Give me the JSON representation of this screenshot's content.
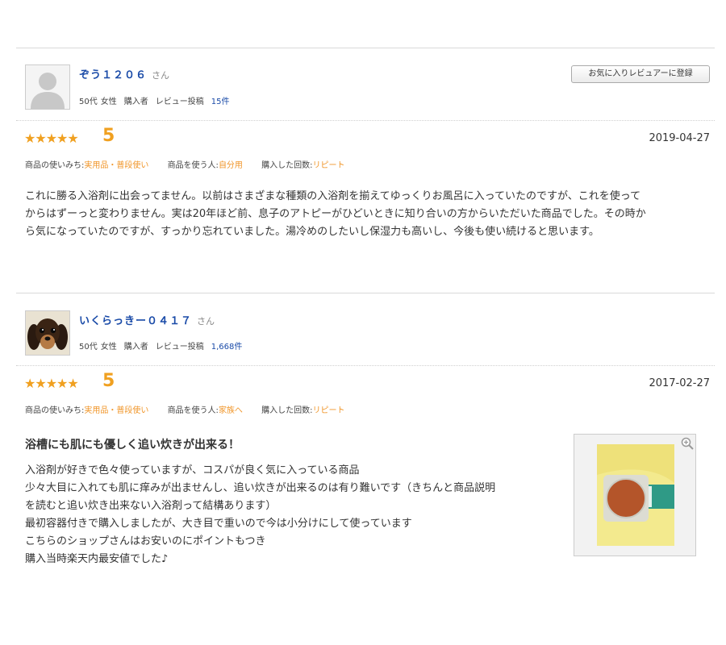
{
  "reviews": [
    {
      "reviewer": {
        "name": "ぞう１２０６",
        "suffix": "さん",
        "age": "50代",
        "gender": "女性",
        "status": "購入者",
        "post_label": "レビュー投稿",
        "post_count": "15件"
      },
      "favorite_button": "お気に入りレビュアーに登録",
      "stars": "★★★★★",
      "score": "5",
      "date": "2019-04-27",
      "attributes": [
        {
          "label": "商品の使いみち:",
          "value": "実用品・普段使い"
        },
        {
          "label": "商品を使う人:",
          "value": "自分用"
        },
        {
          "label": "購入した回数:",
          "value": "リピート"
        }
      ],
      "body_lines": [
        "これに勝る入浴剤に出会ってません。以前はさまざまな種類の入浴剤を揃えてゆっくりお風呂に入っていたのですが、これを使って",
        "からはずーっと変わりません。実は20年ほど前、息子のアトピーがひどいときに知り合いの方からいただいた商品でした。その時か",
        "ら気になっていたのですが、すっかり忘れていました。湯冷めのしたいし保湿力も高いし、今後も使い続けると思います。"
      ]
    },
    {
      "reviewer": {
        "name": "いくらっきー０４１７",
        "suffix": "さん",
        "age": "50代",
        "gender": "女性",
        "status": "購入者",
        "post_label": "レビュー投稿",
        "post_count": "1,668件"
      },
      "stars": "★★★★★",
      "score": "5",
      "date": "2017-02-27",
      "attributes": [
        {
          "label": "商品の使いみち:",
          "value": "実用品・普段使い"
        },
        {
          "label": "商品を使う人:",
          "value": "家族へ"
        },
        {
          "label": "購入した回数:",
          "value": "リピート"
        }
      ],
      "title": "浴槽にも肌にも優しく追い炊きが出来る！",
      "body_lines": [
        "入浴剤が好きで色々使っていますが、コスパが良く気に入っている商品",
        "少々大目に入れても肌に痒みが出ませんし、追い炊きが出来るのは有り難いです（きちんと商品説明",
        "を読むと追い炊き出来ない入浴剤って結構あります）",
        "最初容器付きで購入しましたが、大き目で重いので今は小分けにして使っています",
        "こちらのショップさんはお安いのにポイントもつき",
        "購入当時楽天内最安値でした♪"
      ]
    }
  ],
  "colors": {
    "accent": "#f0a020",
    "link": "#1a4ba8"
  }
}
